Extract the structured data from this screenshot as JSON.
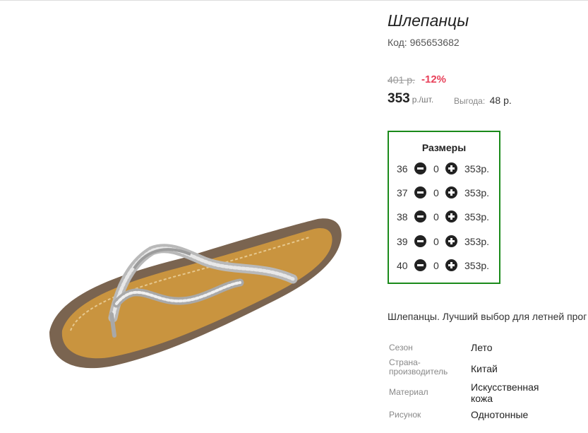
{
  "product": {
    "title": "Шлепанцы",
    "sku": "Код: 965653682",
    "old_price": "401 р.",
    "discount": "-12%",
    "price": "353",
    "price_unit": "р./шт.",
    "savings_label": "Выгода:",
    "savings_value": "48 р.",
    "description": "Шлепанцы. Лучший выбор для летней прог"
  },
  "sizes": {
    "title": "Размеры",
    "rows": [
      {
        "size": "36",
        "qty": "0",
        "price": "353р."
      },
      {
        "size": "37",
        "qty": "0",
        "price": "353р."
      },
      {
        "size": "38",
        "qty": "0",
        "price": "353р."
      },
      {
        "size": "39",
        "qty": "0",
        "price": "353р."
      },
      {
        "size": "40",
        "qty": "0",
        "price": "353р."
      }
    ]
  },
  "attributes": [
    {
      "label": "Сезон",
      "value": "Лето"
    },
    {
      "label": "Страна-производитель",
      "value": "Китай"
    },
    {
      "label": "Материал",
      "value": "Искусственная кожа"
    },
    {
      "label": "Рисунок",
      "value": "Однотонные"
    }
  ],
  "colors": {
    "discount": "#e8415a",
    "sizes_border": "#1a8a1a",
    "control": "#222222"
  },
  "icons": {
    "minus": "minus-circle-icon",
    "plus": "plus-circle-icon"
  }
}
